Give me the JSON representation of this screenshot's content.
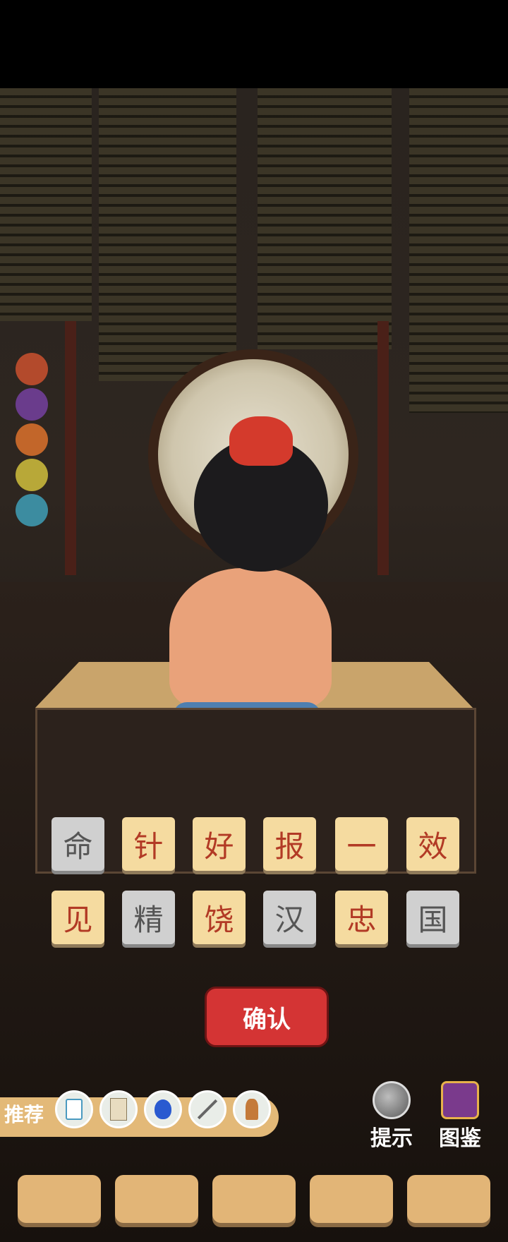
{
  "board": {
    "row1": [
      {
        "char": "命",
        "state": "used"
      },
      {
        "char": "针",
        "state": "available"
      },
      {
        "char": "好",
        "state": "available"
      },
      {
        "char": "报",
        "state": "available"
      },
      {
        "char": "一",
        "state": "available"
      },
      {
        "char": "效",
        "state": "available"
      }
    ],
    "row2": [
      {
        "char": "见",
        "state": "available"
      },
      {
        "char": "精",
        "state": "used"
      },
      {
        "char": "饶",
        "state": "available"
      },
      {
        "char": "汉",
        "state": "used"
      },
      {
        "char": "忠",
        "state": "available"
      },
      {
        "char": "国",
        "state": "used"
      }
    ]
  },
  "confirm_label": "确认",
  "recommend": {
    "label": "推荐",
    "items": [
      "mahjong-tile-icon",
      "scroll-icon",
      "gourd-icon",
      "sword-icon",
      "figurine-icon"
    ]
  },
  "hint_label": "提示",
  "gallery_label": "图鉴",
  "answer_slots": 5,
  "colors": {
    "tile_available": "#f5dba0",
    "tile_used": "#d0d0d0",
    "confirm": "#d43434",
    "wood": "#e2b577"
  }
}
